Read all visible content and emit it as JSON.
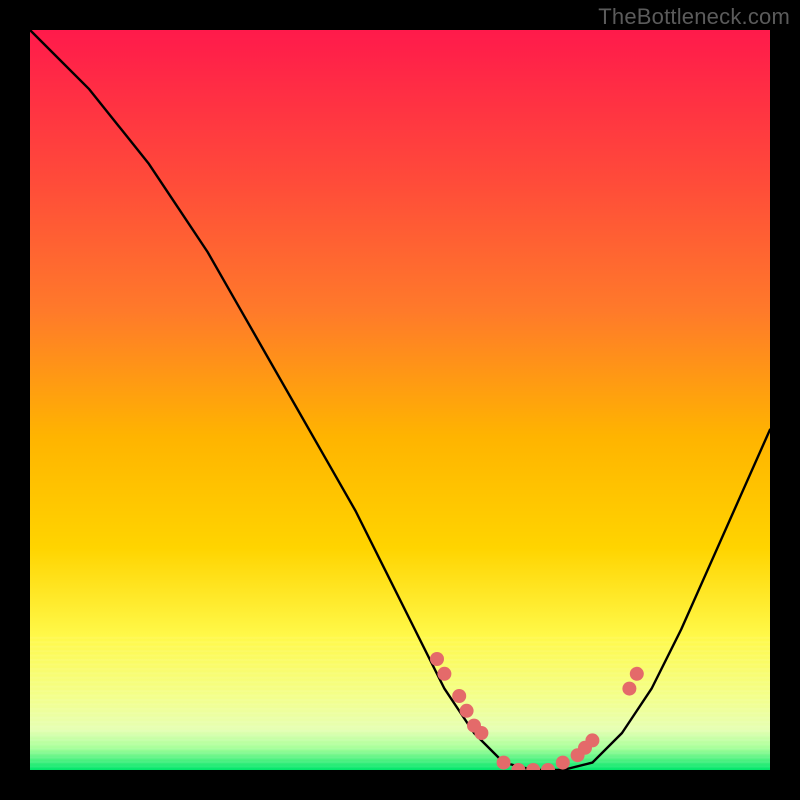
{
  "watermark": "TheBottleneck.com",
  "chart_data": {
    "type": "line",
    "title": "",
    "xlabel": "",
    "ylabel": "",
    "xlim": [
      0,
      100
    ],
    "ylim": [
      0,
      100
    ],
    "gradient_colors": {
      "top": "#ff1a4b",
      "mid_upper": "#ff7a2a",
      "mid": "#ffd400",
      "mid_lower": "#fff94a",
      "low": "#e6ffb3",
      "bottom": "#00e66b"
    },
    "series": [
      {
        "name": "bottleneck-curve",
        "x": [
          0,
          4,
          8,
          12,
          16,
          20,
          24,
          28,
          32,
          36,
          40,
          44,
          48,
          52,
          56,
          60,
          64,
          68,
          72,
          76,
          80,
          84,
          88,
          92,
          96,
          100
        ],
        "y": [
          100,
          96,
          92,
          87,
          82,
          76,
          70,
          63,
          56,
          49,
          42,
          35,
          27,
          19,
          11,
          5,
          1,
          0,
          0,
          1,
          5,
          11,
          19,
          28,
          37,
          46
        ]
      }
    ],
    "markers": {
      "name": "highlight-points",
      "color": "#e46a6a",
      "x": [
        55,
        56,
        58,
        59,
        60,
        61,
        64,
        66,
        68,
        70,
        72,
        74,
        75,
        76,
        81,
        82
      ],
      "y": [
        15,
        13,
        10,
        8,
        6,
        5,
        1,
        0,
        0,
        0,
        1,
        2,
        3,
        4,
        11,
        13
      ]
    }
  }
}
